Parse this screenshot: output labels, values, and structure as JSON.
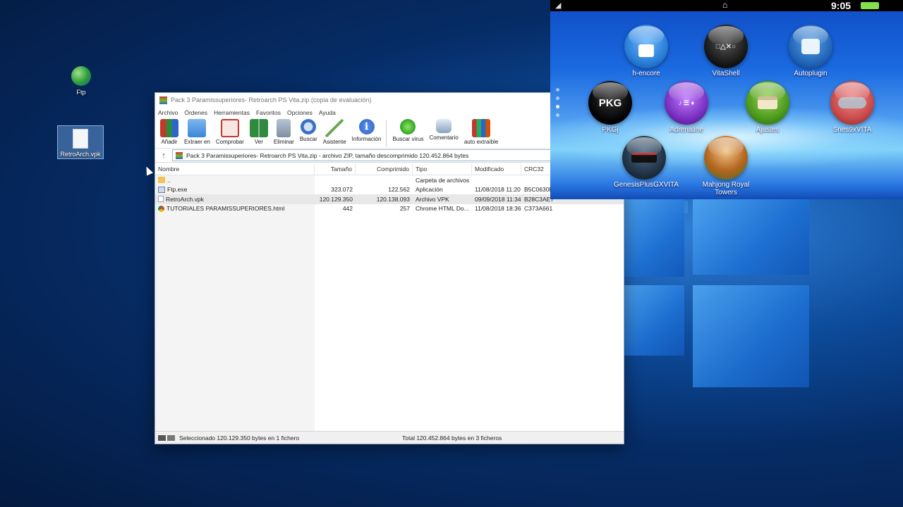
{
  "desktop": {
    "icons": [
      {
        "label": "Ftp",
        "icon": "globe-shortcut-icon"
      },
      {
        "label": "RetroArch.vpk",
        "icon": "blank-file-icon"
      }
    ]
  },
  "winrar": {
    "title": "Pack 3 Paramissuperiores- Retroarch PS Vita.zip (copia de evaluación)",
    "menu": [
      "Archivo",
      "Órdenes",
      "Herramientas",
      "Favoritos",
      "Opciones",
      "Ayuda"
    ],
    "toolbar": [
      {
        "label": "Añadir",
        "icon": "books-add-icon",
        "color": "#c0392b"
      },
      {
        "label": "Extraer en",
        "icon": "folder-extract-icon",
        "color": "#3a86d8"
      },
      {
        "label": "Comprobar",
        "icon": "clipboard-check-icon",
        "color": "#c0392b"
      },
      {
        "label": "Ver",
        "icon": "book-view-icon",
        "color": "#2e8b3e"
      },
      {
        "label": "Eliminar",
        "icon": "trash-icon",
        "color": "#7f8fa3"
      },
      {
        "label": "Buscar",
        "icon": "magnifier-icon",
        "color": "#3b6fc4"
      },
      {
        "label": "Asistente",
        "icon": "wizard-wand-icon",
        "color": "#6aa84f"
      },
      {
        "label": "Información",
        "icon": "info-icon",
        "color": "#2b65c9"
      },
      {
        "label": "Buscar virus",
        "icon": "virus-scan-icon",
        "color": "#3fae2a"
      },
      {
        "label": "Comentario",
        "icon": "comment-icon",
        "color": "#8aa2bf"
      },
      {
        "label": "auto extraíble",
        "icon": "sfx-box-icon",
        "color": "#d35400"
      }
    ],
    "address": "Pack 3 Paramissuperiores- Retroarch PS Vita.zip - archivo ZIP, tamaño descomprimido 120.452.864 bytes",
    "columns": [
      "Nombre",
      "Tamaño",
      "Comprimido",
      "Tipo",
      "Modificado",
      "CRC32"
    ],
    "rows": [
      {
        "name": "..",
        "size": "",
        "packed": "",
        "type": "Carpeta de archivos",
        "modified": "",
        "crc": "",
        "icon": "folder-icon"
      },
      {
        "name": "Ftp.exe",
        "size": "323.072",
        "packed": "122.562",
        "type": "Aplicación",
        "modified": "11/08/2018 11:20",
        "crc": "B5C0630D",
        "icon": "exe-icon"
      },
      {
        "name": "RetroArch.vpk",
        "size": "120.129.350",
        "packed": "120.138.093",
        "type": "Archivo VPK",
        "modified": "09/09/2018 11:34",
        "crc": "B28C3AE7",
        "icon": "file-icon"
      },
      {
        "name": "TUTORIALES PARAMISSUPERIORES.html",
        "size": "442",
        "packed": "257",
        "type": "Chrome HTML Do...",
        "modified": "11/08/2018 18:36",
        "crc": "C373A661",
        "icon": "chrome-icon"
      }
    ],
    "status_left": "Seleccionado 120.129.350 bytes en 1 fichero",
    "status_right": "Total 120.452.864 bytes en 3 ficheros"
  },
  "vita": {
    "clock": "9:05",
    "apps": [
      {
        "label": "h-encore",
        "icon": "padlock-icon",
        "color": "#2a7fd8"
      },
      {
        "label": "VitaShell",
        "icon": "folder-psbuttons-icon",
        "color": "#222222"
      },
      {
        "label": "Autoplugin",
        "icon": "puzzle-icon",
        "color": "#1f62b5"
      },
      {
        "label": "PKGj",
        "icon": "pkg-bag-icon",
        "color": "#111111",
        "text": "PKG"
      },
      {
        "label": "Adrenaline",
        "icon": "psp-glyphs-icon",
        "color": "#7a2fc0"
      },
      {
        "label": "Ajustes",
        "icon": "toolbox-icon",
        "color": "#4a9a1c"
      },
      {
        "label": "Snes9xVITA",
        "icon": "snes-controller-icon",
        "color": "#c94a4a"
      },
      {
        "label": "GenesisPlusGXVITA",
        "icon": "genesis-console-icon",
        "color": "#1a2a3a"
      },
      {
        "label": "Mahjong Royal Towers",
        "icon": "mahjong-queen-icon",
        "color": "#b5651d"
      }
    ]
  }
}
